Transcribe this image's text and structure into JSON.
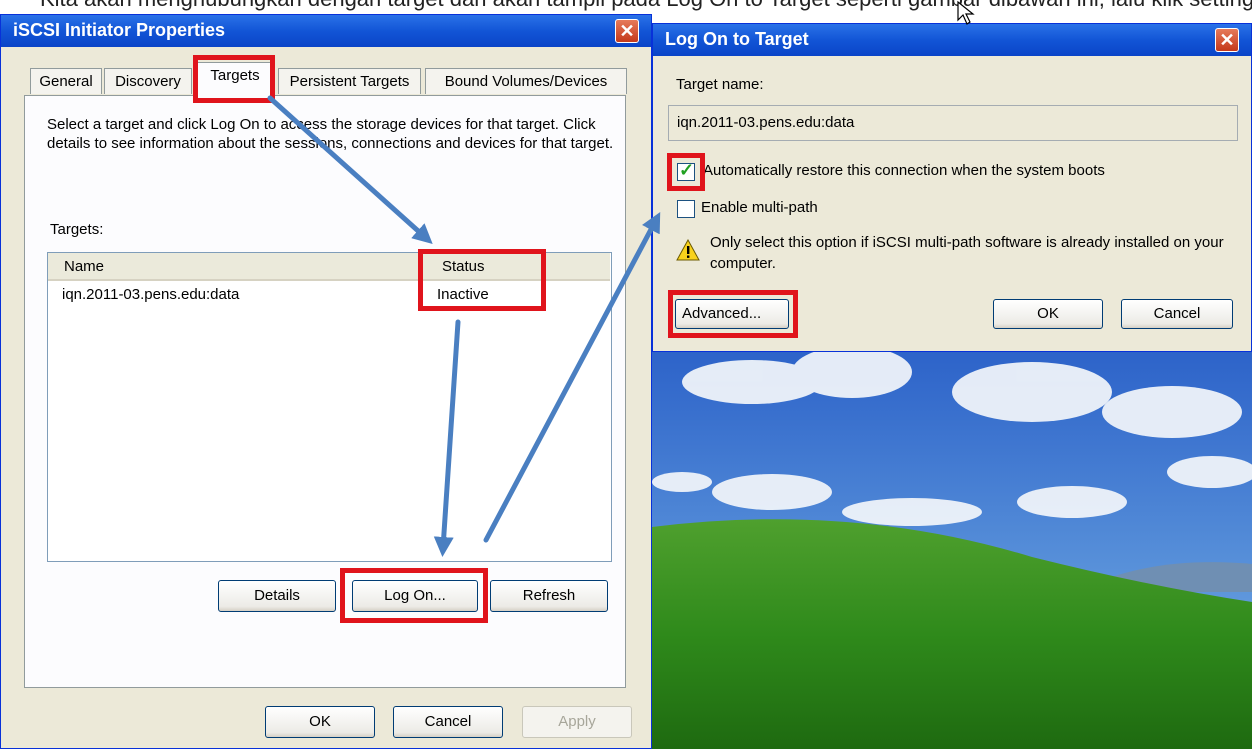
{
  "caption": "Kita akan menghubungkan dengan target dan akan tampil pada Log On to Target seperti gambar dibawah ini, lalu klik setting",
  "left_dialog": {
    "title": "iSCSI Initiator Properties",
    "close_glyph": "✕",
    "tabs": [
      "General",
      "Discovery",
      "Targets",
      "Persistent Targets",
      "Bound Volumes/Devices"
    ],
    "active_tab": "Targets",
    "description": "Select a target and click Log On to access the storage devices for that target. Click details to see information about the sessions, connections and devices for that target.",
    "targets_label": "Targets:",
    "columns": [
      "Name",
      "Status"
    ],
    "rows": [
      {
        "name": "iqn.2011-03.pens.edu:data",
        "status": "Inactive"
      }
    ],
    "buttons": {
      "details": "Details",
      "log_on": "Log On...",
      "refresh": "Refresh"
    },
    "footer": {
      "ok": "OK",
      "cancel": "Cancel",
      "apply": "Apply"
    }
  },
  "right_dialog": {
    "title": "Log On to Target",
    "close_glyph": "✕",
    "target_name_label": "Target name:",
    "target_name_value": "iqn.2011-03.pens.edu:data",
    "auto_restore_label": "Automatically restore this connection when the system boots",
    "auto_restore_checked": true,
    "multipath_label": "Enable multi-path",
    "multipath_checked": false,
    "warning_text": "Only select this option if iSCSI multi-path software is already installed on your computer.",
    "buttons": {
      "advanced": "Advanced...",
      "ok": "OK",
      "cancel": "Cancel"
    }
  },
  "icons": {
    "warning": "warning-icon",
    "cursor": "mouse-cursor-icon",
    "checkmark": "checkmark-icon"
  },
  "colors": {
    "titlebar": "#1255d6",
    "highlight": "#e0141c",
    "arrow": "#4a7fc1",
    "dialog_bg": "#ece9d8"
  }
}
